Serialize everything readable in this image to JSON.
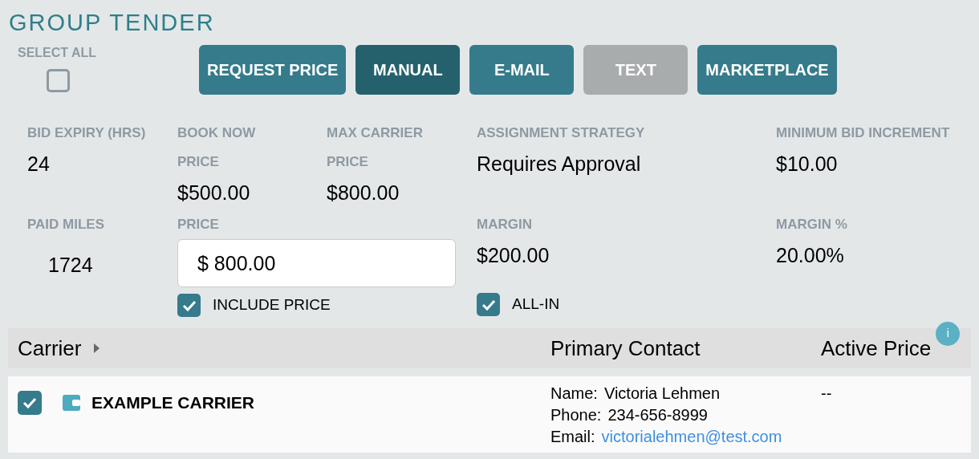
{
  "title": "GROUP TENDER",
  "select_all": {
    "label": "SELECT ALL",
    "checked": false
  },
  "buttons": [
    {
      "label": "REQUEST PRICE",
      "selected": false,
      "disabled": false
    },
    {
      "label": "MANUAL",
      "selected": true,
      "disabled": false
    },
    {
      "label": "E-MAIL",
      "selected": false,
      "disabled": false
    },
    {
      "label": "TEXT",
      "selected": false,
      "disabled": true
    },
    {
      "label": "MARKETPLACE",
      "selected": false,
      "disabled": false
    }
  ],
  "fields": [
    {
      "label": "BID EXPIRY (HRS)",
      "value": "24"
    },
    {
      "label": "BOOK NOW PRICE",
      "value": "$500.00"
    },
    {
      "label": "MAX CARRIER PRICE",
      "value": "$800.00"
    },
    {
      "label": "ASSIGNMENT STRATEGY",
      "value": "Requires Approval"
    },
    {
      "label": "MINIMUM BID INCREMENT",
      "value": "$10.00"
    }
  ],
  "paid_miles": {
    "label": "PAID MILES",
    "value": "1724"
  },
  "price": {
    "label": "PRICE",
    "value": "$ 800.00"
  },
  "include_price": {
    "label": "INCLUDE PRICE",
    "checked": true
  },
  "margin": {
    "label": "MARGIN",
    "value": "$200.00"
  },
  "margin_percent": {
    "label": "MARGIN %",
    "value": "20.00%"
  },
  "all_in": {
    "label": "ALL-IN",
    "checked": true
  },
  "table": {
    "columns": [
      {
        "label": "Carrier"
      },
      {
        "label": "Primary Contact"
      },
      {
        "label": "Active Price",
        "info": "i"
      }
    ],
    "rows": [
      {
        "checked": true,
        "carrier": "EXAMPLE CARRIER",
        "contact": [
          {
            "label": "Name:",
            "value": "Victoria Lehmen",
            "kind": "text"
          },
          {
            "label": "Phone:",
            "value": "234-656-8999",
            "kind": "text"
          },
          {
            "label": "Email:",
            "value": "victorialehmen@test.com",
            "kind": "link"
          }
        ],
        "active_price": "--"
      }
    ]
  }
}
